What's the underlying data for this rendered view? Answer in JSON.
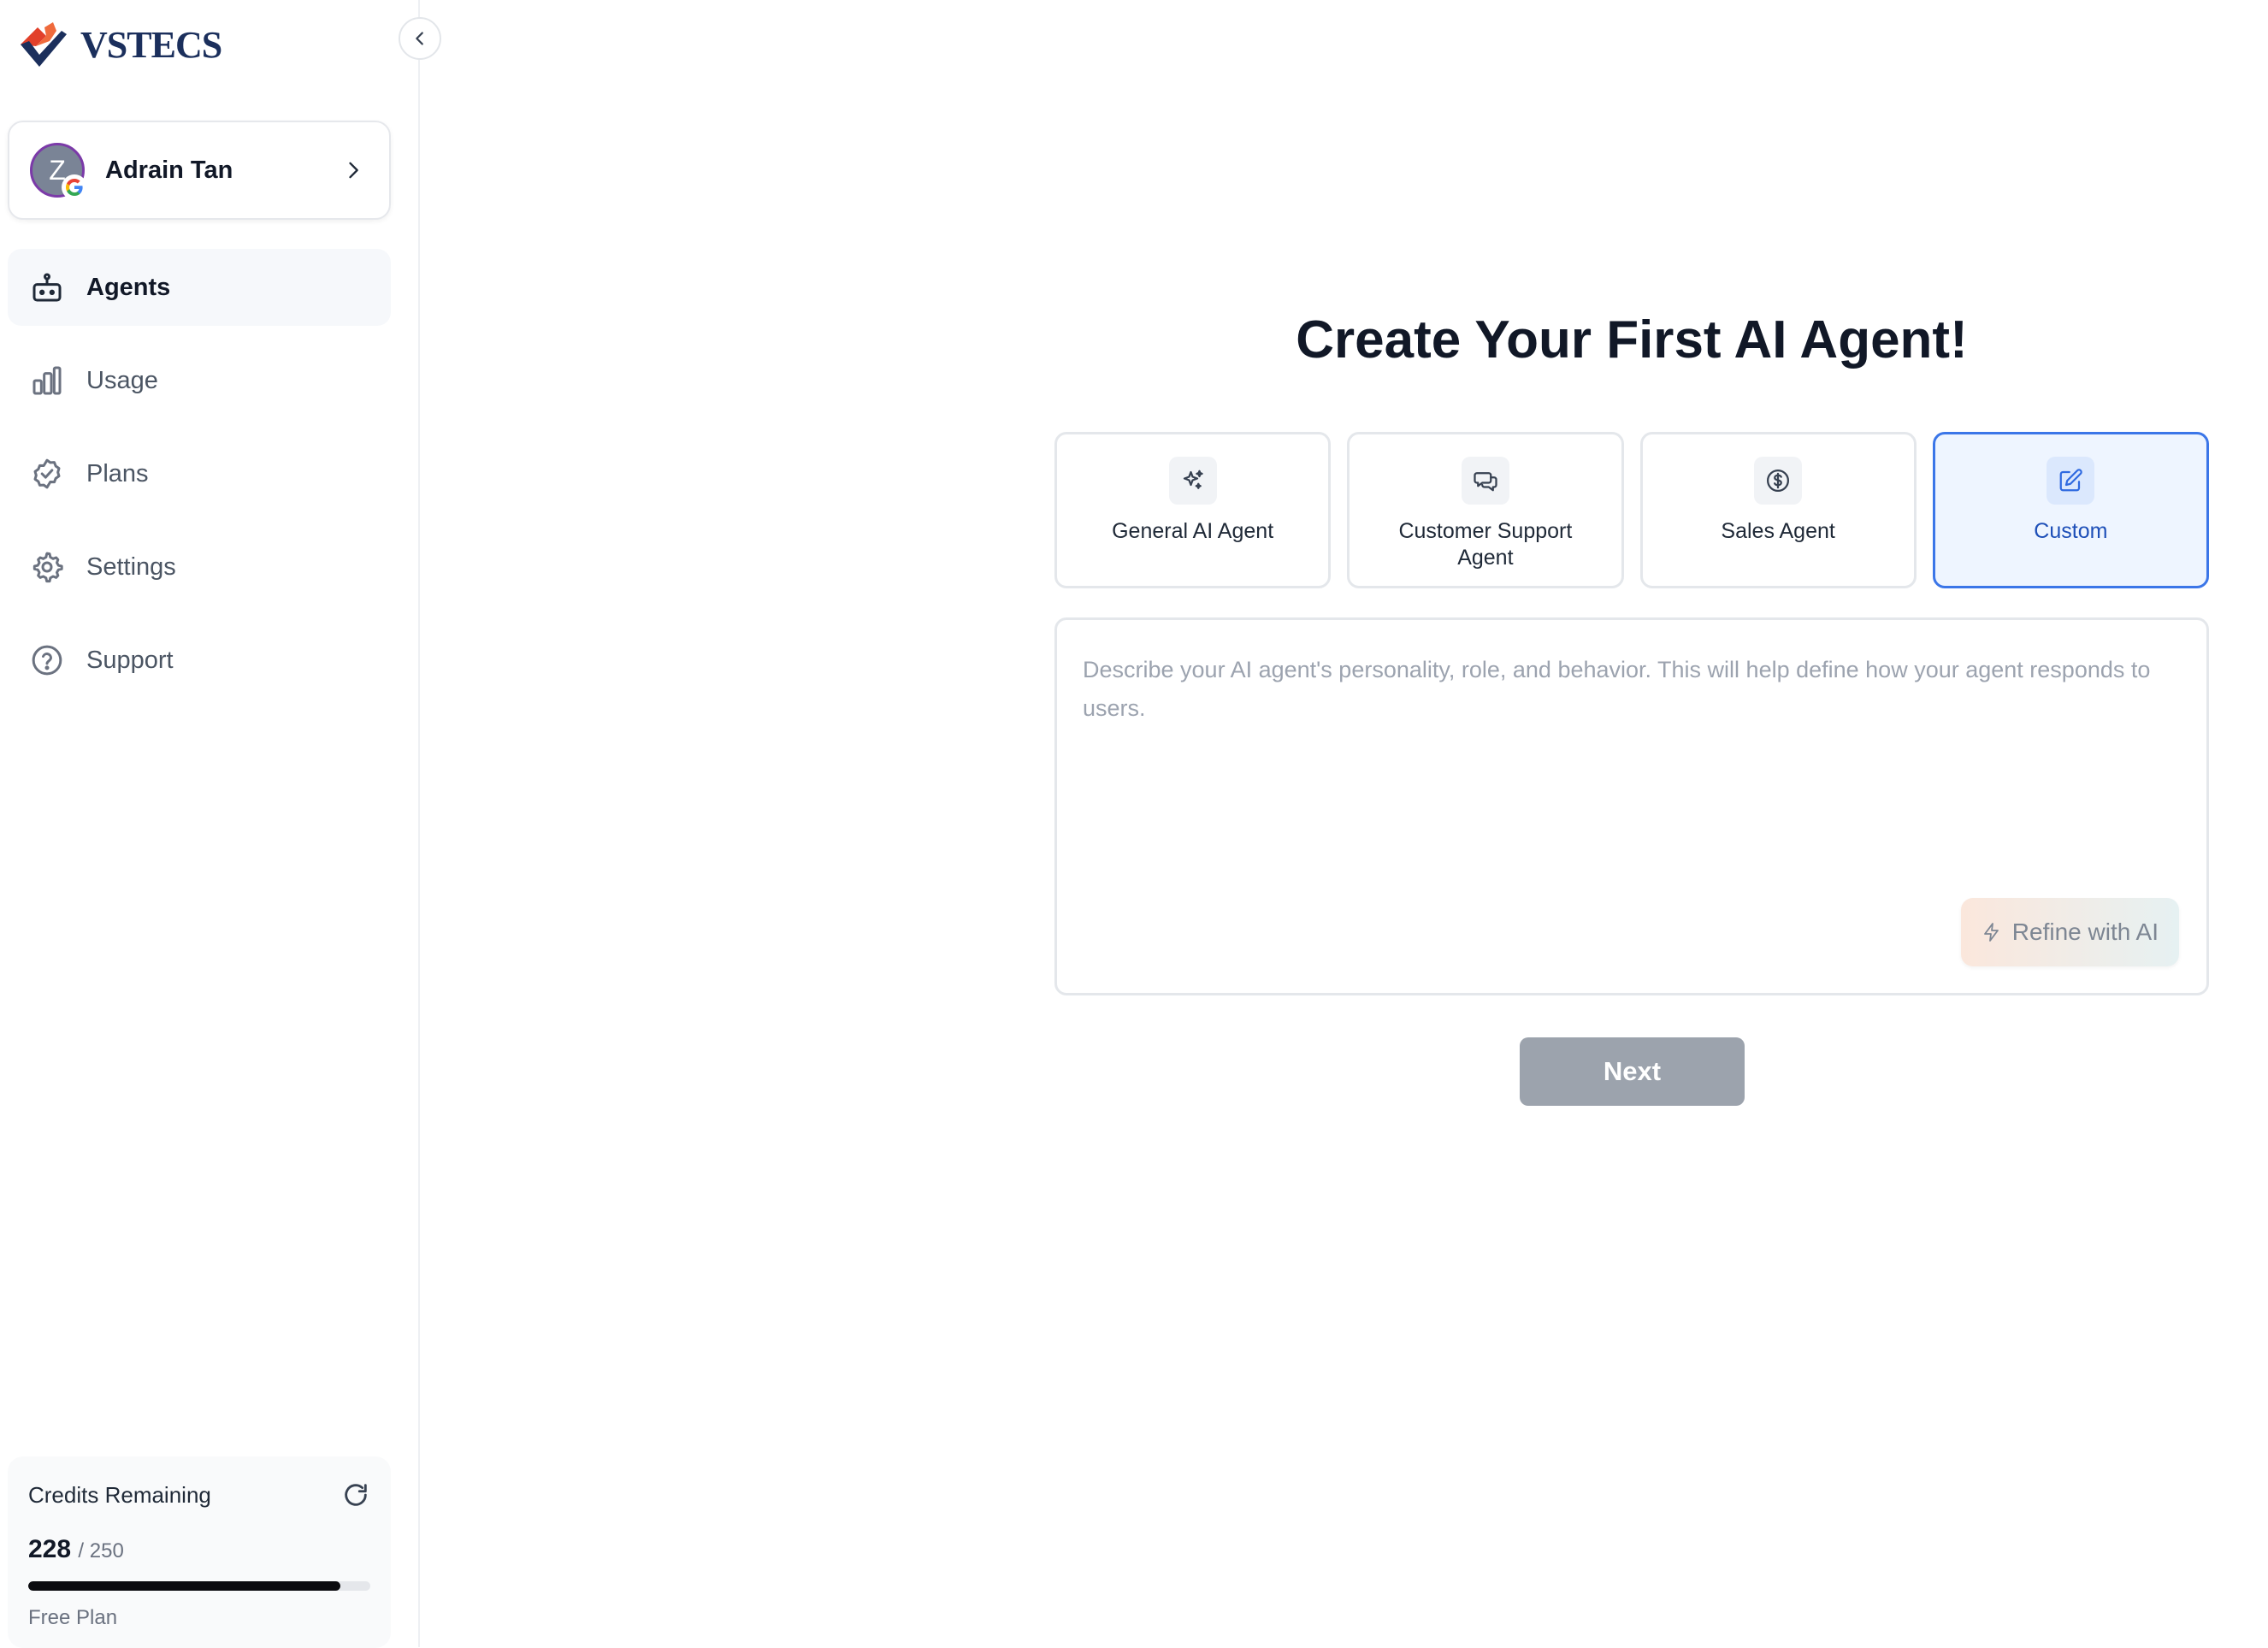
{
  "brand": {
    "name": "VSTECS",
    "colors": {
      "red": "#e2402a",
      "navy": "#1b2f5c"
    }
  },
  "sidebar": {
    "collapse_icon": "chevron-left-icon",
    "user": {
      "initial": "Z",
      "name": "Adrain Tan",
      "provider_icon": "google-icon"
    },
    "items": [
      {
        "label": "Agents",
        "icon": "robot-icon",
        "active": true
      },
      {
        "label": "Usage",
        "icon": "bar-chart-icon",
        "active": false
      },
      {
        "label": "Plans",
        "icon": "badge-check-icon",
        "active": false
      },
      {
        "label": "Settings",
        "icon": "gear-icon",
        "active": false
      },
      {
        "label": "Support",
        "icon": "help-circle-icon",
        "active": false
      }
    ],
    "credits": {
      "label": "Credits Remaining",
      "used": "228",
      "total": "/ 250",
      "fraction": 0.912,
      "plan": "Free Plan"
    }
  },
  "main": {
    "title": "Create Your First AI Agent!",
    "agent_types": [
      {
        "label": "General AI Agent",
        "icon": "sparkles-icon",
        "selected": false
      },
      {
        "label": "Customer Support Agent",
        "icon": "chat-icon",
        "selected": false
      },
      {
        "label": "Sales Agent",
        "icon": "dollar-circle-icon",
        "selected": false
      },
      {
        "label": "Custom",
        "icon": "edit-icon",
        "selected": true
      }
    ],
    "prompt": {
      "value": "",
      "placeholder": "Describe your AI agent's personality, role, and behavior. This will help define how your agent responds to users."
    },
    "refine_label": "Refine with AI",
    "next_label": "Next",
    "accent": "#3b76e8"
  }
}
